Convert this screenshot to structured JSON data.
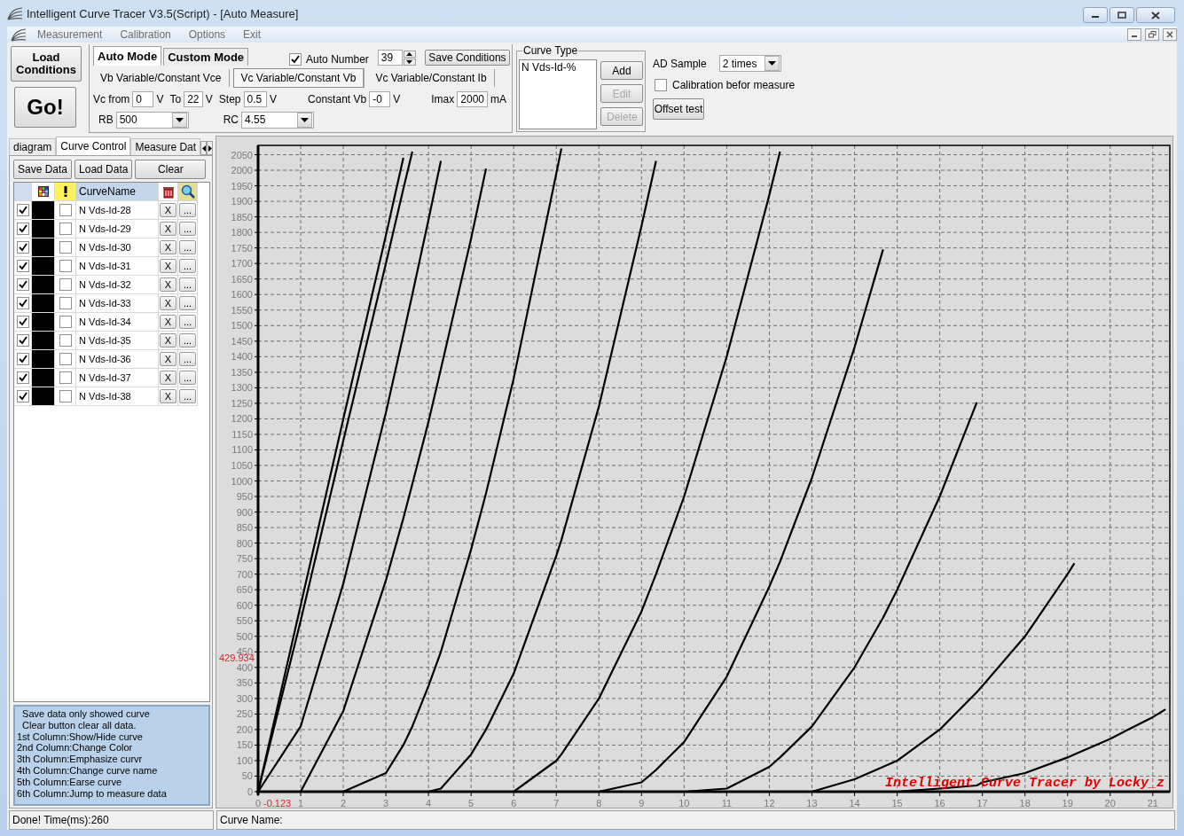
{
  "window": {
    "title": "Intelligent Curve Tracer V3.5(Script) - [Auto Measure]"
  },
  "menu": {
    "items": [
      "Measurement",
      "Calibration",
      "Options",
      "Exit"
    ]
  },
  "toolbar": {
    "load_button": "Load Conditions",
    "go_button": "Go!",
    "mode_tabs": [
      {
        "label": "Auto Mode",
        "selected": true
      },
      {
        "label": "Custom Mode",
        "selected": false
      }
    ],
    "auto_number": {
      "label": "Auto Number",
      "checked": true,
      "value": "39"
    },
    "save_button": "Save Conditions",
    "sub_tabs": [
      {
        "label": "Vb Variable/Constant Vce",
        "selected": false
      },
      {
        "label": "Vc Variable/Constant Vb",
        "selected": true
      },
      {
        "label": "Vc Variable/Constant Ib",
        "selected": false
      }
    ],
    "fields": [
      {
        "label": "Vc from",
        "value": "0",
        "unit": "V",
        "kind": "text"
      },
      {
        "label": "To",
        "value": "22",
        "unit": "V",
        "kind": "text"
      },
      {
        "label": "Step",
        "value": "0.5",
        "unit": "V",
        "kind": "text"
      },
      {
        "label": "Constant Vb",
        "value": "-0",
        "unit": "V",
        "kind": "text"
      },
      {
        "label": "Imax",
        "value": "2000",
        "unit": "mA",
        "kind": "text"
      },
      {
        "label": "RB",
        "value": "500",
        "kind": "dropdown"
      },
      {
        "label": "RC",
        "value": "4.55",
        "kind": "dropdown"
      }
    ],
    "curve_type": {
      "title": "Curve Type",
      "items": [
        "N Vds-Id-%"
      ],
      "buttons": [
        {
          "label": "Add",
          "disabled": false
        },
        {
          "label": "Edit",
          "disabled": true
        },
        {
          "label": "Delete",
          "disabled": true
        }
      ]
    },
    "ad_sample": {
      "label": "AD Sample",
      "value": "2 times"
    },
    "calibration": {
      "label": "Calibration befor measure",
      "checked": false
    },
    "offset_button": "Offset test"
  },
  "left_panel": {
    "tabs": [
      {
        "label": "diagram",
        "selected": false
      },
      {
        "label": "Curve Control",
        "selected": true
      },
      {
        "label": "Measure Dat",
        "selected": false
      }
    ],
    "buttons": [
      "Save Data",
      "Load Data",
      "Clear"
    ],
    "table": {
      "columns": [
        "CurveName"
      ],
      "rows": [
        {
          "shown": true,
          "color": "#000000",
          "emphasized": false,
          "name": "N Vds-Id-28",
          "erase": "X",
          "jump": "..."
        },
        {
          "shown": true,
          "color": "#000000",
          "emphasized": false,
          "name": "N Vds-Id-29",
          "erase": "X",
          "jump": "..."
        },
        {
          "shown": true,
          "color": "#000000",
          "emphasized": false,
          "name": "N Vds-Id-30",
          "erase": "X",
          "jump": "..."
        },
        {
          "shown": true,
          "color": "#000000",
          "emphasized": false,
          "name": "N Vds-Id-31",
          "erase": "X",
          "jump": "..."
        },
        {
          "shown": true,
          "color": "#000000",
          "emphasized": false,
          "name": "N Vds-Id-32",
          "erase": "X",
          "jump": "..."
        },
        {
          "shown": true,
          "color": "#000000",
          "emphasized": false,
          "name": "N Vds-Id-33",
          "erase": "X",
          "jump": "..."
        },
        {
          "shown": true,
          "color": "#000000",
          "emphasized": false,
          "name": "N Vds-Id-34",
          "erase": "X",
          "jump": "..."
        },
        {
          "shown": true,
          "color": "#000000",
          "emphasized": false,
          "name": "N Vds-Id-35",
          "erase": "X",
          "jump": "..."
        },
        {
          "shown": true,
          "color": "#000000",
          "emphasized": false,
          "name": "N Vds-Id-36",
          "erase": "X",
          "jump": "..."
        },
        {
          "shown": true,
          "color": "#000000",
          "emphasized": false,
          "name": "N Vds-Id-37",
          "erase": "X",
          "jump": "..."
        },
        {
          "shown": true,
          "color": "#000000",
          "emphasized": false,
          "name": "N Vds-Id-38",
          "erase": "X",
          "jump": "..."
        }
      ]
    },
    "help": [
      "  Save data only showed curve",
      "  Clear button clear all data.",
      "1st Column:Show/Hide curve",
      "2nd Column:Change Color",
      "3th Column:Emphasize curvr",
      "4th Column:Change curve name",
      "5th Column:Earse curve",
      "6th Column:Jump to measure data"
    ]
  },
  "chart": {
    "chart_data": {
      "type": "line",
      "xlim": [
        0,
        21.4
      ],
      "ylim": [
        0,
        2080
      ],
      "xticks": [
        0,
        1,
        2,
        3,
        4,
        5,
        6,
        7,
        8,
        9,
        10,
        11,
        12,
        13,
        14,
        15,
        16,
        17,
        18,
        19,
        20,
        21
      ],
      "yticks": [
        0,
        50,
        100,
        150,
        200,
        250,
        300,
        350,
        400,
        450,
        500,
        550,
        600,
        650,
        700,
        750,
        800,
        850,
        900,
        950,
        1000,
        1050,
        1100,
        1150,
        1200,
        1250,
        1300,
        1350,
        1400,
        1450,
        1500,
        1550,
        1600,
        1650,
        1700,
        1750,
        1800,
        1850,
        1900,
        1950,
        2000,
        2050
      ],
      "x": [
        0,
        1,
        2,
        3,
        3.41,
        3.62,
        4,
        4.29,
        5,
        5.35,
        6,
        7,
        7.12,
        8,
        9,
        9.34,
        10,
        11,
        12,
        12.25,
        13,
        14,
        14.67,
        15,
        16,
        16.87,
        17,
        18,
        19,
        19.16,
        20,
        21,
        21.3
      ],
      "series": [
        {
          "color": "#000000",
          "values": [
            0,
            600,
            1200,
            1790,
            2040,
            null,
            null,
            null,
            null,
            null,
            null,
            null,
            null,
            null,
            null,
            null,
            null,
            null,
            null,
            null,
            null,
            null,
            null,
            null,
            null,
            null,
            null,
            null,
            null,
            null,
            null,
            null,
            null
          ]
        },
        {
          "color": "#000000",
          "values": [
            0,
            550,
            1130,
            1700,
            1940,
            2060,
            null,
            null,
            null,
            null,
            null,
            null,
            null,
            null,
            null,
            null,
            null,
            null,
            null,
            null,
            null,
            null,
            null,
            null,
            null,
            null,
            null,
            null,
            null,
            null,
            null,
            null,
            null
          ]
        },
        {
          "color": "#000000",
          "values": [
            0,
            210,
            670,
            1220,
            1470,
            1600,
            1840,
            2030,
            null,
            null,
            null,
            null,
            null,
            null,
            null,
            null,
            null,
            null,
            null,
            null,
            null,
            null,
            null,
            null,
            null,
            null,
            null,
            null,
            null,
            null,
            null,
            null,
            null
          ]
        },
        {
          "color": "#000000",
          "values": [
            0,
            0,
            260,
            680,
            880,
            990,
            1190,
            1360,
            1780,
            2005,
            null,
            null,
            null,
            null,
            null,
            null,
            null,
            null,
            null,
            null,
            null,
            null,
            null,
            null,
            null,
            null,
            null,
            null,
            null,
            null,
            null,
            null,
            null
          ]
        },
        {
          "color": "#000000",
          "values": [
            0,
            0,
            0,
            60,
            150,
            210,
            340,
            450,
            780,
            960,
            1330,
            1990,
            2070,
            null,
            null,
            null,
            null,
            null,
            null,
            null,
            null,
            null,
            null,
            null,
            null,
            null,
            null,
            null,
            null,
            null,
            null,
            null,
            null
          ]
        },
        {
          "color": "#000000",
          "values": [
            0,
            0,
            0,
            0,
            0,
            0,
            0,
            10,
            120,
            200,
            380,
            760,
            810,
            1240,
            1820,
            2030,
            null,
            null,
            null,
            null,
            null,
            null,
            null,
            null,
            null,
            null,
            null,
            null,
            null,
            null,
            null,
            null,
            null
          ]
        },
        {
          "color": "#000000",
          "values": [
            0,
            0,
            0,
            0,
            0,
            0,
            0,
            0,
            0,
            0,
            0,
            100,
            120,
            300,
            580,
            700,
            950,
            1400,
            1920,
            2060,
            null,
            null,
            null,
            null,
            null,
            null,
            null,
            null,
            null,
            null,
            null,
            null,
            null
          ]
        },
        {
          "color": "#000000",
          "values": [
            0,
            0,
            0,
            0,
            0,
            0,
            0,
            0,
            0,
            0,
            0,
            0,
            0,
            0,
            30,
            70,
            160,
            370,
            660,
            740,
            1010,
            1430,
            1745,
            null,
            null,
            null,
            null,
            null,
            null,
            null,
            null,
            null,
            null
          ]
        },
        {
          "color": "#000000",
          "values": [
            0,
            0,
            0,
            0,
            0,
            0,
            0,
            0,
            0,
            0,
            0,
            0,
            0,
            0,
            0,
            0,
            0,
            10,
            80,
            110,
            210,
            400,
            560,
            650,
            950,
            1253,
            null,
            null,
            null,
            null,
            null,
            null,
            null
          ]
        },
        {
          "color": "#000000",
          "values": [
            0,
            0,
            0,
            0,
            0,
            0,
            0,
            0,
            0,
            0,
            0,
            0,
            0,
            0,
            0,
            0,
            0,
            0,
            0,
            0,
            0,
            40,
            80,
            100,
            200,
            320,
            340,
            500,
            700,
            735,
            null,
            null,
            null
          ]
        },
        {
          "color": "#000000",
          "values": [
            0,
            0,
            0,
            0,
            0,
            0,
            0,
            0,
            0,
            0,
            0,
            0,
            0,
            0,
            0,
            0,
            0,
            0,
            0,
            0,
            0,
            0,
            0,
            0,
            10,
            20,
            30,
            60,
            110,
            120,
            170,
            240,
            265
          ]
        }
      ],
      "grid": true,
      "annotations": [
        "429.934",
        "-0.123",
        "Intelligent Curve Tracer by Locky_z"
      ]
    }
  },
  "status_bar": {
    "left": "Done!  Time(ms):260",
    "right": "Curve Name:"
  }
}
